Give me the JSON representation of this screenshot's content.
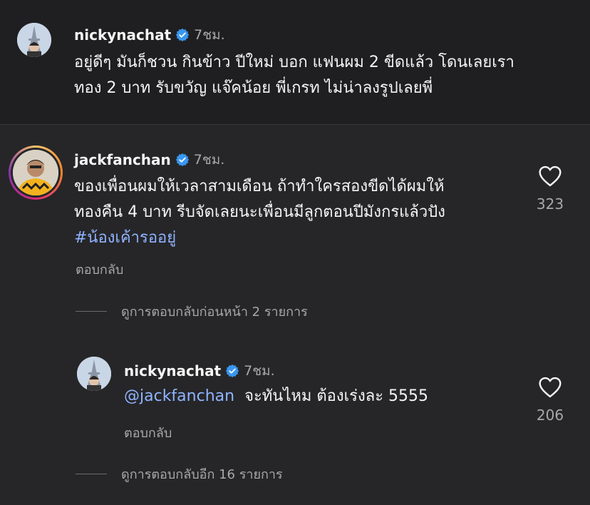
{
  "colors": {
    "mention": "#8fb3ff",
    "verified": "#3897f0",
    "text": "#f5f5f5",
    "muted": "#a8a8a8"
  },
  "comments": [
    {
      "username": "nickynachat",
      "time": "7ชม.",
      "line1": "อยู่ดีๆ มันก็ชวน กินข้าว ปีใหม่ บอก แฟนผม 2 ขีดแล้ว โดนเลยเรา",
      "line2": "ทอง 2 บาท รับขวัญ แจ๊คน้อย พี่เกรท ไม่น่าลงรูปเลยพี่"
    },
    {
      "username": "jackfanchan",
      "time": "7ชม.",
      "line1": "ของเพื่อนผมให้เวลาสามเดือน ถ้าทำใครสองขีดได้ผมให้",
      "line2": "ทองคืน 4 บาท  รีบจัดเลยนะเพื่อนมีลูกตอนปีมังกรแล้วปัง",
      "hashtag": "#น้องเค้ารออยู่",
      "reply_label": "ตอบกลับ",
      "likes": "323",
      "view_previous": "ดูการตอบกลับก่อนหน้า 2 รายการ"
    },
    {
      "username": "nickynachat",
      "time": "7ชม.",
      "mention": "@jackfanchan",
      "text": "จะทันไหม ต้องเร่งละ 5555",
      "reply_label": "ตอบกลับ",
      "likes": "206",
      "view_more": "ดูการตอบกลับอีก 16 รายการ"
    }
  ]
}
